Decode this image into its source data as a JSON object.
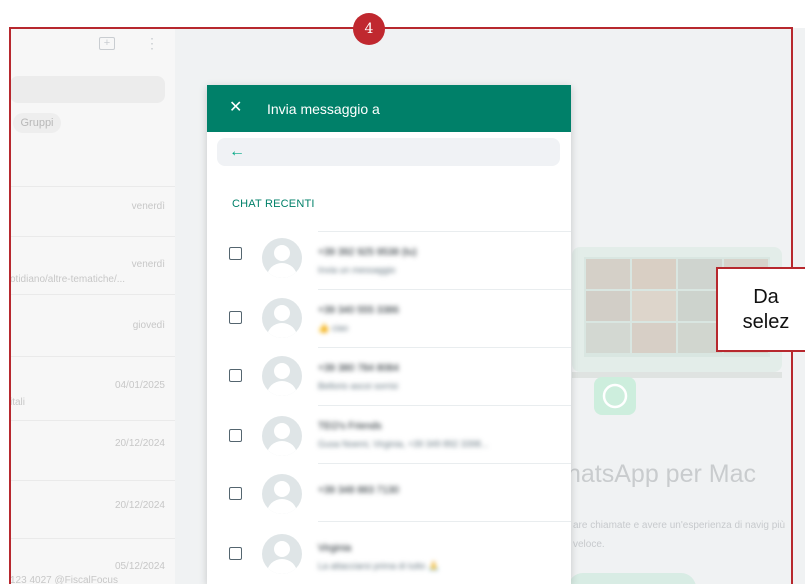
{
  "badge": "4",
  "callout_lines": [
    "Da",
    "selez"
  ],
  "left_panel": {
    "filter_chip": "Gruppi",
    "dates": [
      "venerdì",
      "venerdì",
      "giovedì",
      "04/01/2025",
      "20/12/2024",
      "20/12/2024",
      "05/12/2024"
    ],
    "snippets": [
      "otidiano/altre-tematiche/...",
      "itali",
      "123 4027 @FiscalFocus"
    ]
  },
  "right_panel": {
    "title": "hatsApp per Mac",
    "subtitle": "are chiamate e avere un'esperienza di navig più veloce."
  },
  "modal": {
    "title": "Invia messaggio a",
    "section": "CHAT RECENTI",
    "contacts": [
      {
        "name": "+39 392 925 9538 (tu)",
        "sub": "Invia un messaggio"
      },
      {
        "name": "+39 340 555 3386",
        "sub": "👍 ciao"
      },
      {
        "name": "+39 380 784 8084",
        "sub": "Bellorio ascoi sorrisi"
      },
      {
        "name": "TEO's Friends",
        "sub": "Gusa Noemi, Virginia, +39 349 892 3398..."
      },
      {
        "name": "+39 348 883 7130",
        "sub": ""
      },
      {
        "name": "Virginia",
        "sub": "La attacciarsi prima di tutto 🙏"
      }
    ]
  },
  "colors": {
    "accent": "#008069",
    "highlight": "#b7282e"
  }
}
